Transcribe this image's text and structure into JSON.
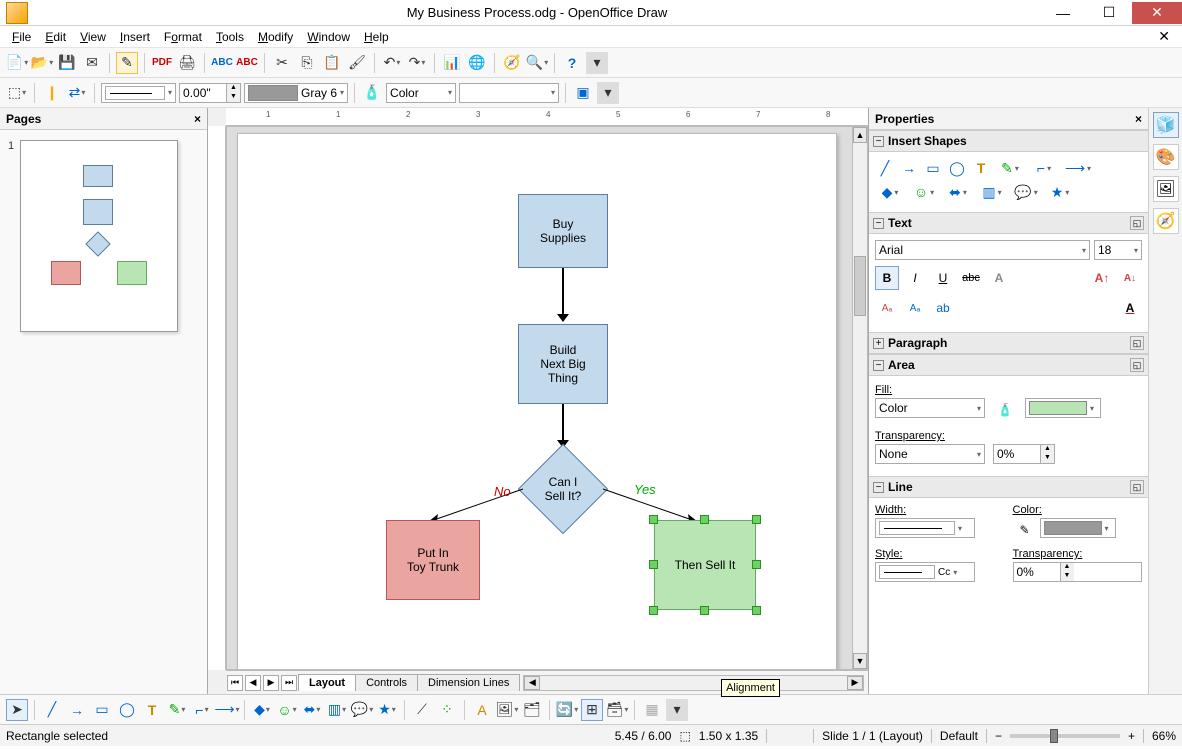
{
  "window": {
    "title": "My Business Process.odg - OpenOffice Draw"
  },
  "menus": [
    "File",
    "Edit",
    "View",
    "Insert",
    "Format",
    "Tools",
    "Modify",
    "Window",
    "Help"
  ],
  "toolbar1": {
    "line_width": "0.00\"",
    "line_color_label": "Gray 6",
    "fill_label": "Color"
  },
  "pages_panel": {
    "title": "Pages",
    "page_num": "1"
  },
  "flowchart": {
    "box1": "Buy\nSupplies",
    "box2": "Build\nNext Big\nThing",
    "decision": "Can I\nSell It?",
    "no_label": "No",
    "yes_label": "Yes",
    "left": "Put In\nToy Trunk",
    "right": "Then Sell It"
  },
  "tabs": [
    "Layout",
    "Controls",
    "Dimension Lines"
  ],
  "properties": {
    "title": "Properties",
    "insert_shapes": "Insert Shapes",
    "text": "Text",
    "font_name": "Arial",
    "font_size": "18",
    "paragraph": "Paragraph",
    "area": "Area",
    "fill_label": "Fill:",
    "fill_type": "Color",
    "transparency_label": "Transparency:",
    "transparency_type": "None",
    "transparency_val": "0%",
    "line": "Line",
    "width_label": "Width:",
    "color_label": "Color:",
    "style_label": "Style:",
    "style_val": "Cc",
    "line_transp": "0%"
  },
  "tooltip": "Alignment",
  "status": {
    "selected": "Rectangle selected",
    "pos": "5.45 / 6.00",
    "size": "1.50 x 1.35",
    "slide": "Slide 1 / 1 (Layout)",
    "style": "Default",
    "zoom": "66%"
  }
}
